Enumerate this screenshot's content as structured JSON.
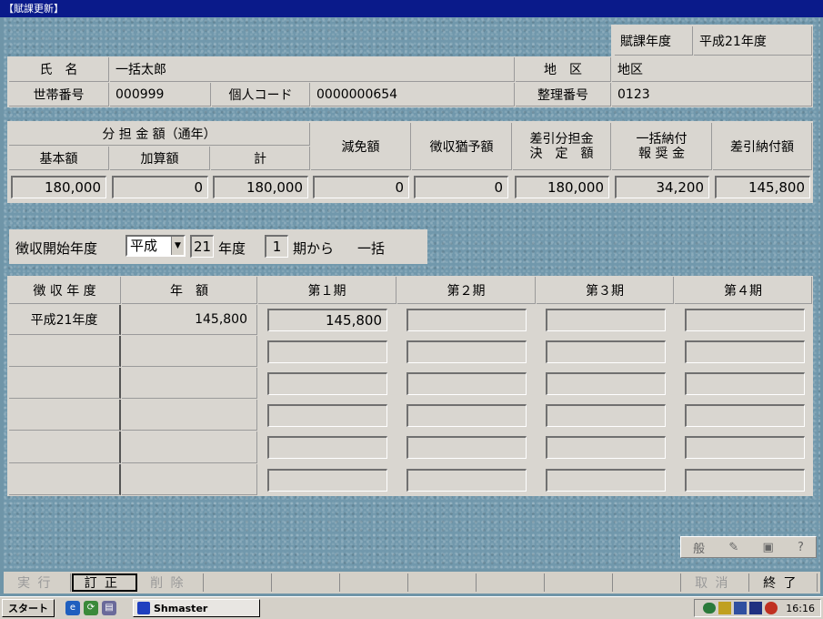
{
  "window": {
    "title": "【賦課更新】"
  },
  "header": {
    "fiscal_year_label": "賦課年度",
    "fiscal_year_value": "平成21年度",
    "name_label": "氏　名",
    "name_value": "一括太郎",
    "district_label": "地　区",
    "district_value": "地区",
    "household_no_label": "世帯番号",
    "household_no_value": "000999",
    "personal_code_label": "個人コード",
    "personal_code_value": "0000000654",
    "ref_no_label": "整理番号",
    "ref_no_value": "0123"
  },
  "amounts": {
    "group_label": "分 担 金 額（通年）",
    "basic_label": "基本額",
    "additional_label": "加算額",
    "total_label": "計",
    "reduction_label": "減免額",
    "deferral_label": "徴収猶予額",
    "net_share_label_1": "差引分担金",
    "net_share_label_2": "決　定　額",
    "lump_reward_label_1": "一括納付",
    "lump_reward_label_2": "報 奨 金",
    "net_payment_label": "差引納付額",
    "basic": "180,000",
    "additional": "0",
    "total": "180,000",
    "reduction": "0",
    "deferral": "0",
    "net_share": "180,000",
    "lump_reward": "34,200",
    "net_payment": "145,800"
  },
  "start": {
    "label": "徴収開始年度",
    "era": "平成",
    "year": "21",
    "year_suffix": "年度",
    "period": "1",
    "period_suffix": "期から",
    "mode": "一括"
  },
  "schedule": {
    "col_year": "徴 収 年 度",
    "col_amount": "年　額",
    "col_p1": "第１期",
    "col_p2": "第２期",
    "col_p3": "第３期",
    "col_p4": "第４期",
    "rows": [
      {
        "year": "平成21年度",
        "amount": "145,800",
        "p1": "145,800",
        "p2": "",
        "p3": "",
        "p4": ""
      },
      {
        "year": "",
        "amount": "",
        "p1": "",
        "p2": "",
        "p3": "",
        "p4": ""
      },
      {
        "year": "",
        "amount": "",
        "p1": "",
        "p2": "",
        "p3": "",
        "p4": ""
      },
      {
        "year": "",
        "amount": "",
        "p1": "",
        "p2": "",
        "p3": "",
        "p4": ""
      },
      {
        "year": "",
        "amount": "",
        "p1": "",
        "p2": "",
        "p3": "",
        "p4": ""
      },
      {
        "year": "",
        "amount": "",
        "p1": "",
        "p2": "",
        "p3": "",
        "p4": ""
      }
    ]
  },
  "fkeys": {
    "execute": "実行",
    "correct": "訂正",
    "delete": "削除",
    "cancel": "取消",
    "exit": "終了"
  },
  "ime": {
    "mode": "般"
  },
  "taskbar": {
    "start": "スタート",
    "app": "Shmaster",
    "clock": "16:16"
  }
}
